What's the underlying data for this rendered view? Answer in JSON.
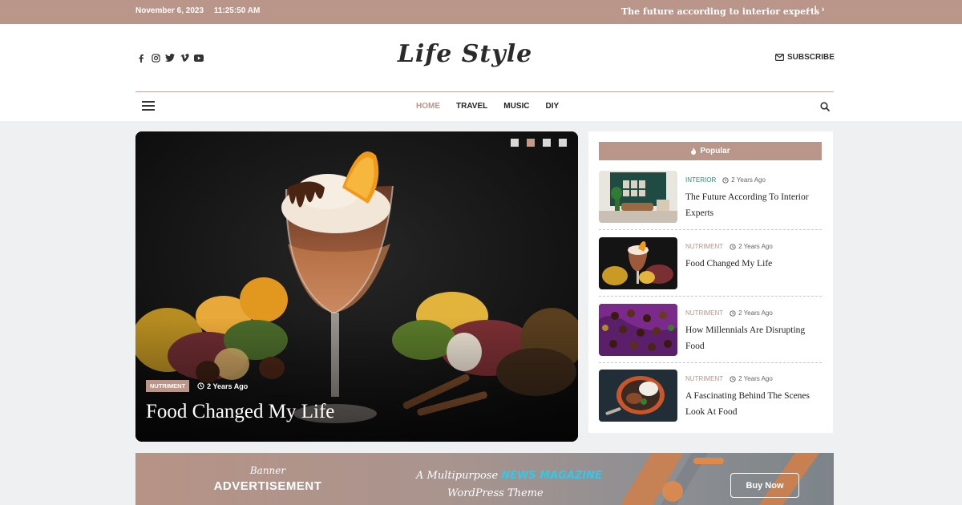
{
  "topbar": {
    "date": "November 6, 2023",
    "time": "11:25:50 AM",
    "ticker": "The future according to interior experts",
    "prev": "‹",
    "divider": "|",
    "next": "›"
  },
  "header": {
    "logo": "Life Style",
    "subscribe": "SUBSCRIBE",
    "social_icons": [
      "facebook-icon",
      "instagram-icon",
      "twitter-icon",
      "vimeo-icon",
      "youtube-icon"
    ]
  },
  "nav": {
    "items": [
      {
        "label": "HOME",
        "active": true
      },
      {
        "label": "TRAVEL",
        "active": false
      },
      {
        "label": "MUSIC",
        "active": false
      },
      {
        "label": "DIY",
        "active": false
      }
    ]
  },
  "hero": {
    "category": "NUTRIMENT",
    "time_ago": "2 Years Ago",
    "title": "Food Changed My Life",
    "slide_count": 4,
    "active_slide": 2
  },
  "sidebar": {
    "heading": "Popular",
    "posts": [
      {
        "category": "INTERIOR",
        "time_ago": "2 Years Ago",
        "title": "The Future According To Interior Experts"
      },
      {
        "category": "NUTRIMENT",
        "time_ago": "2 Years Ago",
        "title": "Food Changed My Life"
      },
      {
        "category": "NUTRIMENT",
        "time_ago": "2 Years Ago",
        "title": "How Millennials Are Disrupting Food"
      },
      {
        "category": "NUTRIMENT",
        "time_ago": "2 Years Ago",
        "title": "A Fascinating Behind The Scenes Look At Food"
      }
    ]
  },
  "banner": {
    "line1": "Banner",
    "line2": "ADVERTISEMENT",
    "tagline_prefix": "A Multipurpose",
    "tagline_highlight": "NEWS MAGAZINE",
    "tagline_suffix": "WordPress Theme",
    "cta": "Buy Now"
  },
  "colors": {
    "accent": "#b9958a",
    "interior_category": "#2f8a6b",
    "banner_highlight": "#35c7e8"
  }
}
